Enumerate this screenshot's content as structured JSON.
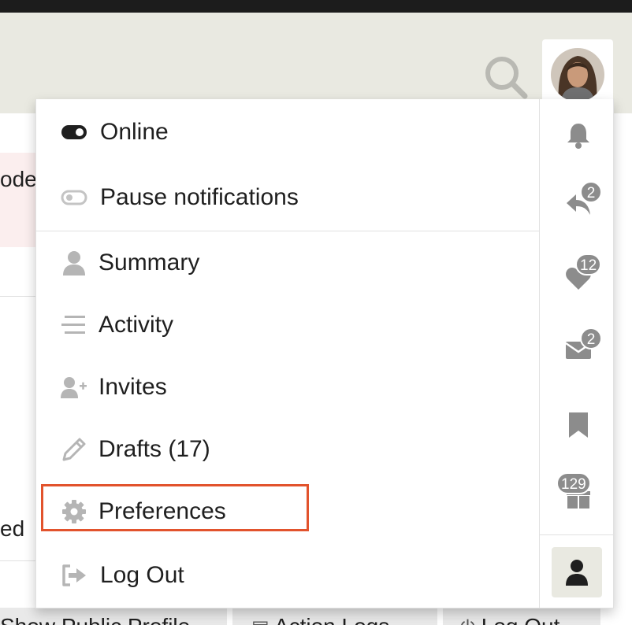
{
  "header": {
    "search_icon": "search-icon",
    "avatar_alt": "User avatar"
  },
  "background": {
    "fragment_top": "ode",
    "fragment_bottom": "ed",
    "buttons": [
      {
        "label": "Show Public Profile",
        "icon": "none"
      },
      {
        "label": "Action Logs",
        "icon": "list-icon"
      },
      {
        "label": "Log Out",
        "icon": "power-icon"
      }
    ]
  },
  "menu": {
    "status": [
      {
        "label": "Online",
        "icon": "toggle-on-icon"
      },
      {
        "label": "Pause notifications",
        "icon": "toggle-off-icon"
      }
    ],
    "items": [
      {
        "label": "Summary",
        "icon": "user-icon"
      },
      {
        "label": "Activity",
        "icon": "stream-icon"
      },
      {
        "label": "Invites",
        "icon": "user-plus-icon"
      },
      {
        "label": "Drafts (17)",
        "icon": "pencil-icon"
      },
      {
        "label": "Preferences",
        "icon": "gear-icon"
      },
      {
        "label": "Log Out",
        "icon": "sign-out-icon"
      }
    ],
    "highlighted": "Preferences"
  },
  "sidebar": {
    "tabs": [
      {
        "name": "notifications",
        "icon": "bell-icon",
        "badge": ""
      },
      {
        "name": "replies",
        "icon": "reply-icon",
        "badge": "2"
      },
      {
        "name": "likes",
        "icon": "heart-icon",
        "badge": "12"
      },
      {
        "name": "messages",
        "icon": "envelope-icon",
        "badge": "2"
      },
      {
        "name": "bookmarks",
        "icon": "bookmark-icon",
        "badge": ""
      },
      {
        "name": "badges",
        "icon": "gift-icon",
        "badge": "129"
      },
      {
        "name": "profile",
        "icon": "user-icon",
        "badge": ""
      }
    ]
  },
  "colors": {
    "header_bg": "#e9e9e1",
    "highlight": "#e2532d",
    "icon_gray": "#8c8c8c",
    "badge_bg": "#8c8c8c"
  }
}
